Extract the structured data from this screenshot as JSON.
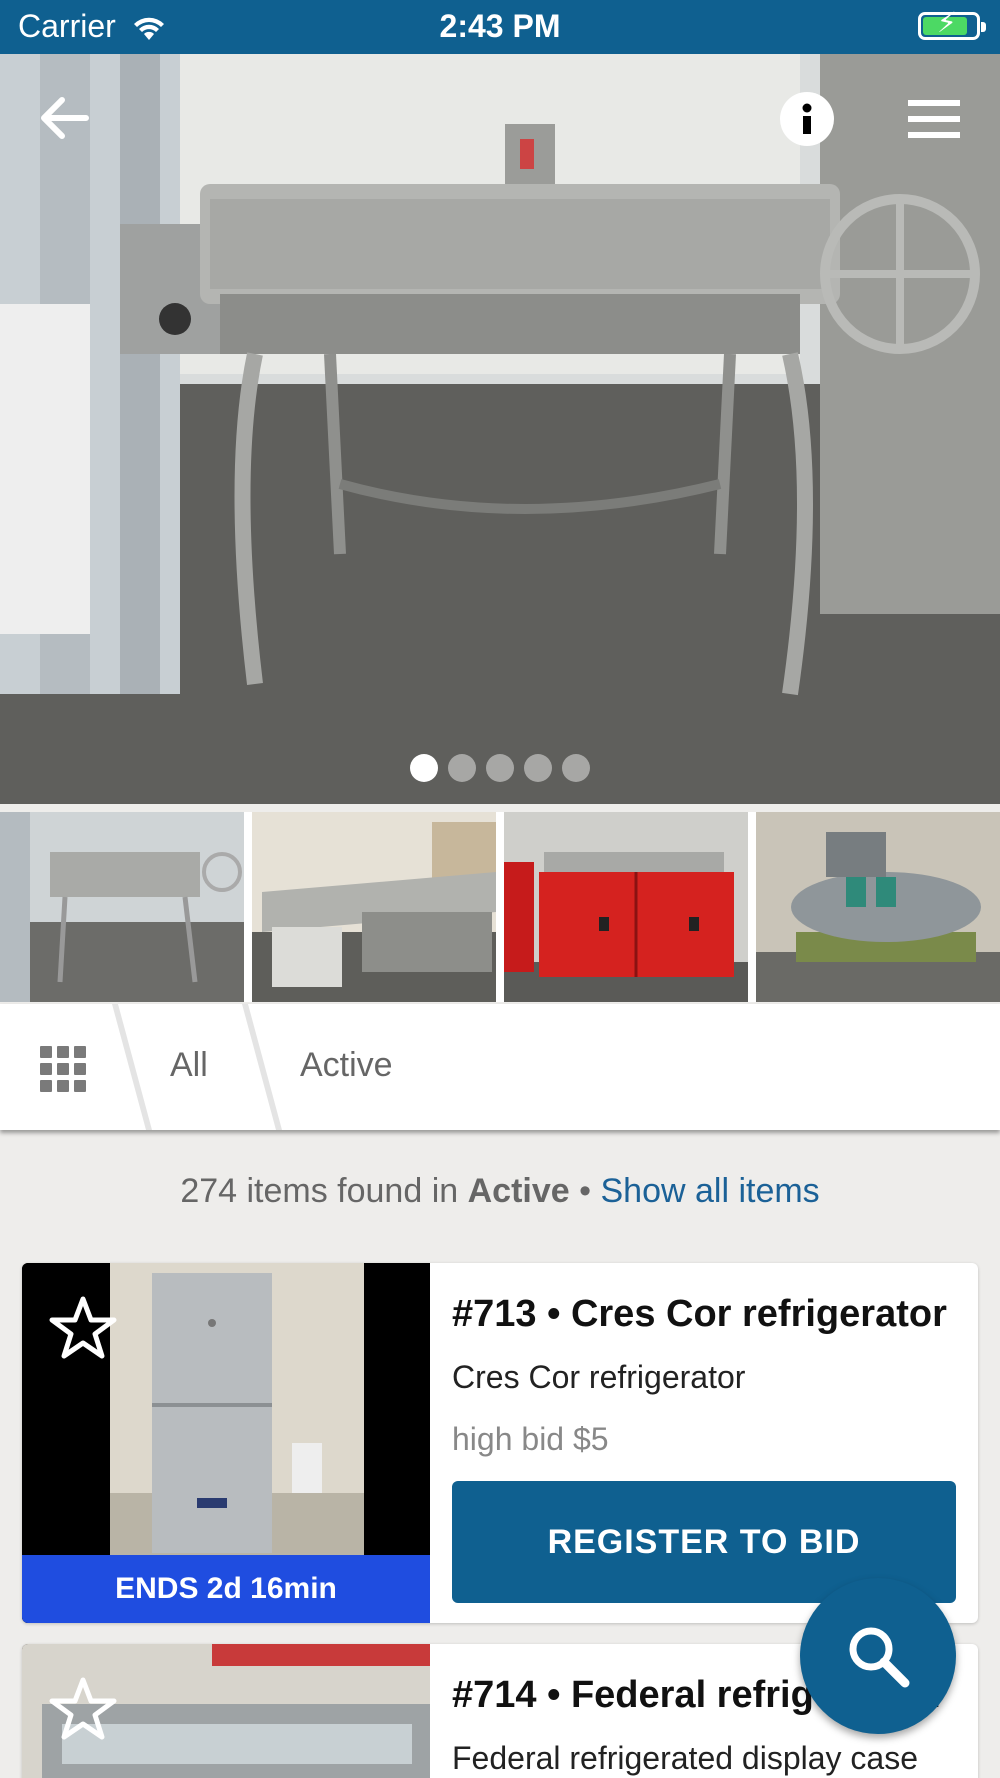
{
  "status_bar": {
    "carrier": "Carrier",
    "time": "2:43 PM",
    "battery_level": 0.85
  },
  "hero": {
    "icons": {
      "back": "arrow-left-icon",
      "info": "info-icon",
      "menu": "hamburger-menu-icon"
    },
    "carousel": {
      "count": 5,
      "active_index": 0
    }
  },
  "thumbnails": [
    {
      "name": "thumbnail-tilt-skillet"
    },
    {
      "name": "thumbnail-prep-counter"
    },
    {
      "name": "thumbnail-red-cabinet"
    },
    {
      "name": "thumbnail-air-compressor"
    }
  ],
  "tabs": {
    "grid_icon": "grid-icon",
    "all_label": "All",
    "active_label": "Active"
  },
  "results": {
    "count_text": "274 items found in",
    "filter_name": "Active",
    "separator": "•",
    "show_all_label": "Show all items"
  },
  "items": [
    {
      "title": "#713 • Cres Cor refrigerator",
      "subtitle": "Cres Cor refrigerator",
      "bid": "high bid $5",
      "ends": "ENDS 2d 16min",
      "button": "REGISTER TO BID"
    },
    {
      "title": "#714 • Federal refrigerated display case",
      "subtitle": "Federal refrigerated display case"
    }
  ],
  "fab": {
    "icon": "search-icon"
  },
  "colors": {
    "brand": "#0f6090",
    "ends_banner": "#1f4de0",
    "link": "#1b6197"
  }
}
